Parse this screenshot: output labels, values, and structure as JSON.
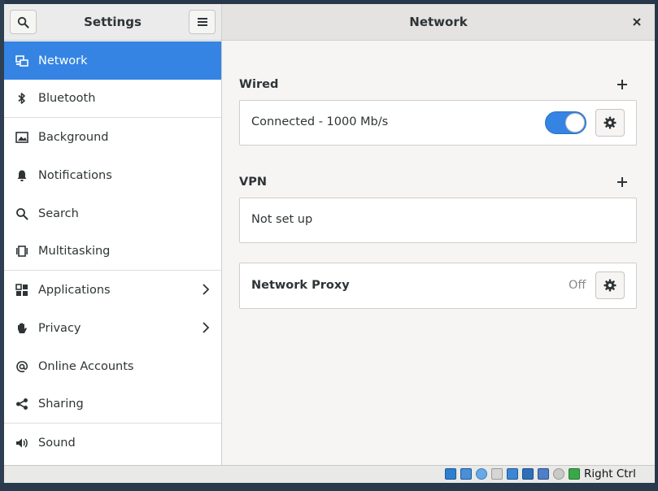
{
  "window": {
    "sidebar_title": "Settings",
    "panel_title": "Network"
  },
  "sidebar": {
    "items": [
      {
        "label": "Network",
        "icon": "network-icon"
      },
      {
        "label": "Bluetooth",
        "icon": "bluetooth-icon"
      },
      {
        "label": "Background",
        "icon": "background-icon"
      },
      {
        "label": "Notifications",
        "icon": "bell-icon"
      },
      {
        "label": "Search",
        "icon": "search-icon"
      },
      {
        "label": "Multitasking",
        "icon": "multitasking-icon"
      },
      {
        "label": "Applications",
        "icon": "apps-grid-icon"
      },
      {
        "label": "Privacy",
        "icon": "hand-icon"
      },
      {
        "label": "Online Accounts",
        "icon": "at-icon"
      },
      {
        "label": "Sharing",
        "icon": "share-icon"
      },
      {
        "label": "Sound",
        "icon": "speaker-icon"
      }
    ]
  },
  "network": {
    "wired": {
      "title": "Wired",
      "status": "Connected - 1000 Mb/s",
      "enabled": true
    },
    "vpn": {
      "title": "VPN",
      "status": "Not set up"
    },
    "proxy": {
      "label": "Network Proxy",
      "status": "Off"
    }
  },
  "statusbar": {
    "host_key": "Right Ctrl"
  },
  "colors": {
    "accent": "#3584e4",
    "sidebar_bg": "#ffffff",
    "content_bg": "#f6f5f4"
  }
}
